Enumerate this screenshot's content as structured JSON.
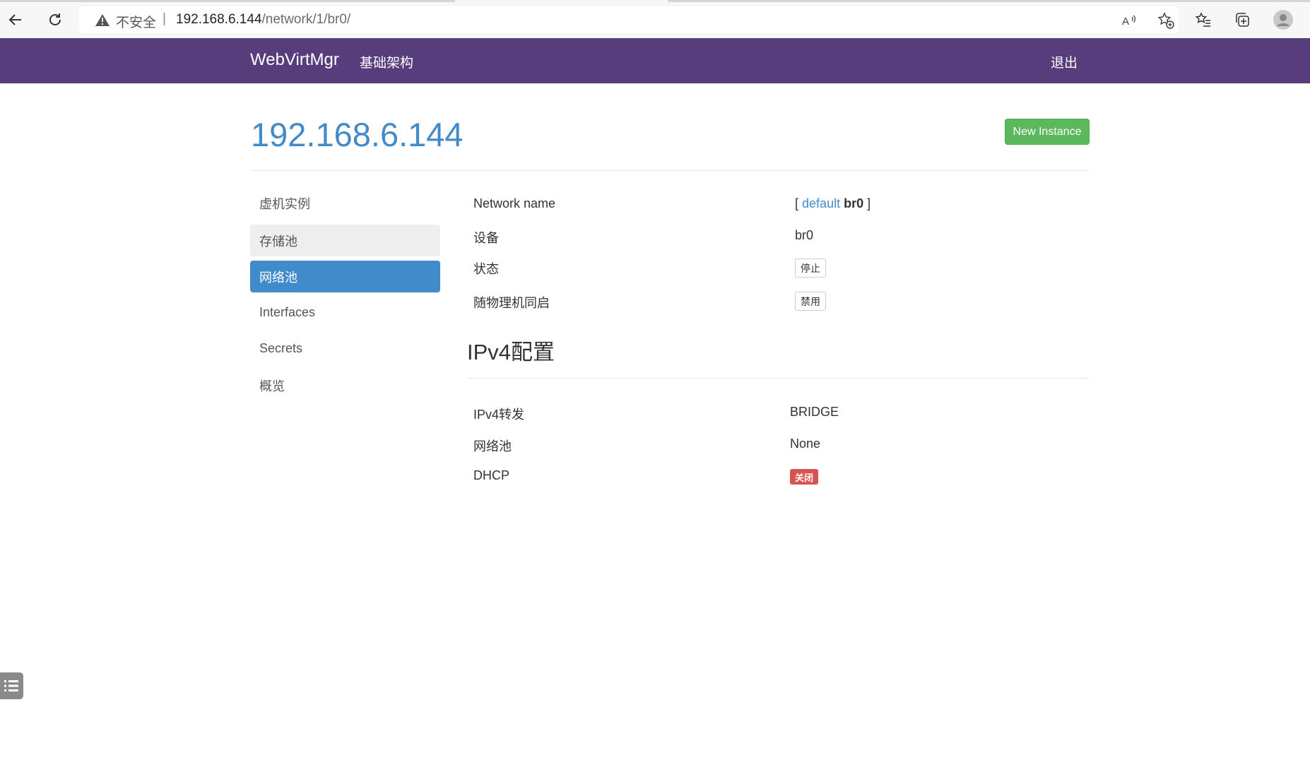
{
  "browser": {
    "security_label": "不安全",
    "separator": "|",
    "url_host": "192.168.6.144",
    "url_path": "/network/1/br0/",
    "icons": [
      "back-icon",
      "reload-icon",
      "warning-icon",
      "read-aloud-icon",
      "add-favorite-icon",
      "favorites-icon",
      "collections-icon",
      "profile-icon"
    ]
  },
  "navbar": {
    "brand": "WebVirtMgr",
    "infrastructure": "基础架构",
    "logout": "退出",
    "color": "#583d7d"
  },
  "header": {
    "title": "192.168.6.144",
    "new_instance": "New Instance"
  },
  "sidebar": {
    "items": [
      {
        "label": "虚机实例",
        "state": "normal"
      },
      {
        "label": "存储池",
        "state": "hover"
      },
      {
        "label": "网络池",
        "state": "active"
      },
      {
        "label": "Interfaces",
        "state": "normal"
      },
      {
        "label": "Secrets",
        "state": "normal"
      },
      {
        "label": "概览",
        "state": "normal"
      }
    ]
  },
  "network": {
    "name_label": "Network name",
    "name_open": "[",
    "name_link": "default",
    "name_current": "br0",
    "name_close": "]",
    "device_label": "设备",
    "device_value": "br0",
    "state_label": "状态",
    "state_button": "停止",
    "autostart_label": "随物理机同启",
    "autostart_button": "禁用"
  },
  "ipv4": {
    "section_title": "IPv4配置",
    "forward_label": "IPv4转发",
    "forward_value": "BRIDGE",
    "pool_label": "网络池",
    "pool_value": "None",
    "dhcp_label": "DHCP",
    "dhcp_badge": "关闭"
  }
}
